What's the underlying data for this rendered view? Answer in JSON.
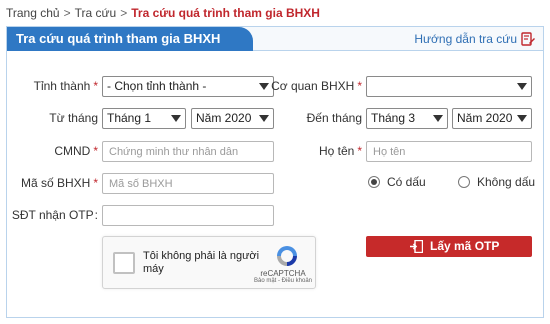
{
  "breadcrumb": {
    "items": [
      "Trang chủ",
      "Tra cứu"
    ],
    "separator": ">",
    "current": "Tra cứu quá trình tham gia BHXH"
  },
  "panel": {
    "title": "Tra cứu quá trình tham gia BHXH",
    "guide_link": "Hướng dẫn tra cứu"
  },
  "form": {
    "required_mark": "*",
    "province": {
      "label": "Tỉnh thành",
      "value": "- Chọn tỉnh thành -"
    },
    "agency": {
      "label": "Cơ quan BHXH",
      "value": ""
    },
    "from": {
      "label": "Từ tháng",
      "month": "Tháng 1",
      "year": "Năm 2020"
    },
    "to": {
      "label": "Đến tháng",
      "month": "Tháng 3",
      "year": "Năm 2020"
    },
    "id_card": {
      "label": "CMND",
      "placeholder": "Chứng minh thư nhân dân"
    },
    "name": {
      "label": "Họ tên",
      "placeholder": "Họ tên"
    },
    "insurance_no": {
      "label": "Mã số BHXH",
      "placeholder": "Mã số BHXH"
    },
    "accent": {
      "with_label": "Có dấu",
      "without_label": "Không dấu",
      "selected": "with"
    },
    "phone": {
      "label": "SĐT nhận OTP",
      "required_mark": ":"
    }
  },
  "recaptcha": {
    "text": "Tôi không phải là người máy",
    "brand": "reCAPTCHA",
    "privacy": "Bảo mật - Điều khoản"
  },
  "otp_button": {
    "label": "Lấy mã OTP"
  },
  "colors": {
    "header_blue": "#2f78c4",
    "accent_red": "#c0272d",
    "button_red": "#c62a2a",
    "link_blue": "#2f6fb4"
  }
}
